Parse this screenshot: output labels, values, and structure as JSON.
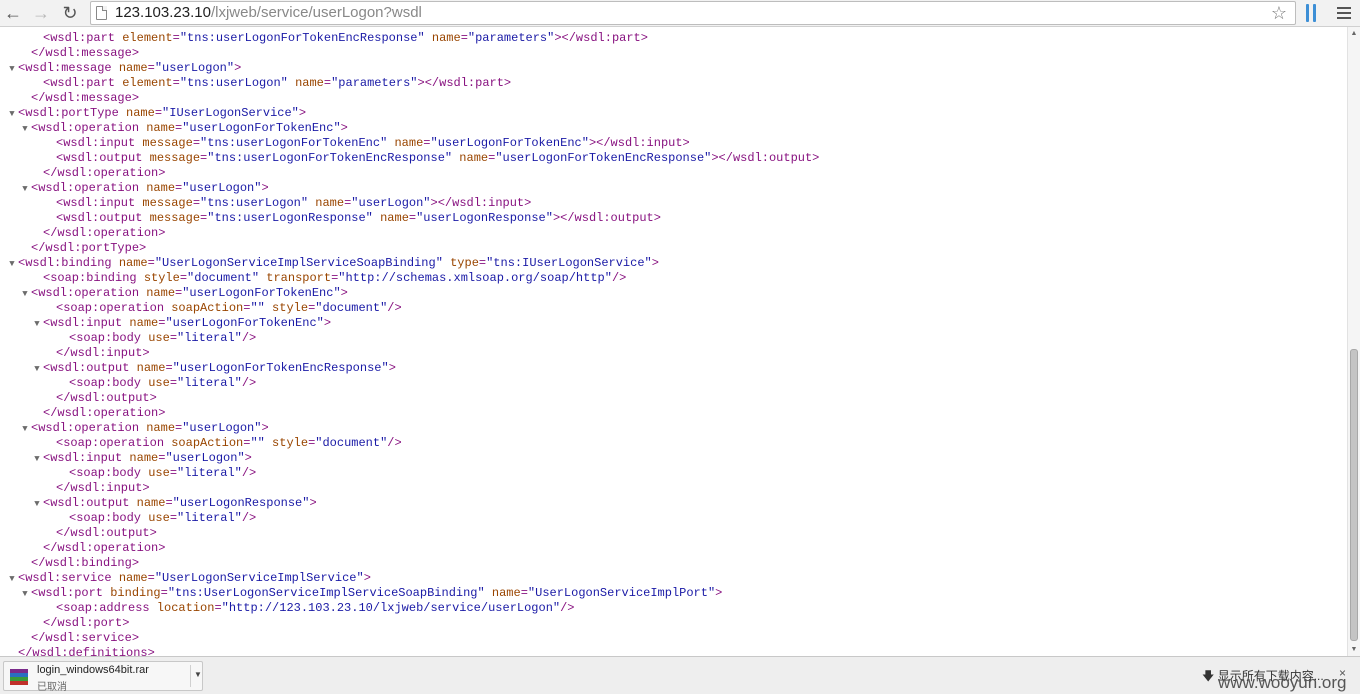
{
  "browser": {
    "url_host": "123.103.23.10",
    "url_path": "/lxjweb/service/userLogon?wsdl",
    "icons": {
      "back": "back-arrow-icon",
      "forward": "forward-arrow-icon",
      "reload": "reload-icon",
      "bookmark": "star-icon",
      "extension": "extension-icon",
      "menu": "menu-icon"
    }
  },
  "xml_lines": [
    {
      "indent": 3,
      "toggle": false,
      "parts": [
        [
          "t",
          "<wsdl:part "
        ],
        [
          "a",
          "element"
        ],
        [
          "t",
          "="
        ],
        [
          "v",
          "\"tns:userLogonForTokenEncResponse\""
        ],
        [
          "t",
          " "
        ],
        [
          "a",
          "name"
        ],
        [
          "t",
          "="
        ],
        [
          "v",
          "\"parameters\""
        ],
        [
          "t",
          "></wsdl:part>"
        ]
      ]
    },
    {
      "indent": 2,
      "toggle": false,
      "parts": [
        [
          "t",
          "</wsdl:message>"
        ]
      ]
    },
    {
      "indent": 1,
      "toggle": true,
      "parts": [
        [
          "t",
          "<wsdl:message "
        ],
        [
          "a",
          "name"
        ],
        [
          "t",
          "="
        ],
        [
          "v",
          "\"userLogon\""
        ],
        [
          "t",
          ">"
        ]
      ]
    },
    {
      "indent": 3,
      "toggle": false,
      "parts": [
        [
          "t",
          "<wsdl:part "
        ],
        [
          "a",
          "element"
        ],
        [
          "t",
          "="
        ],
        [
          "v",
          "\"tns:userLogon\""
        ],
        [
          "t",
          " "
        ],
        [
          "a",
          "name"
        ],
        [
          "t",
          "="
        ],
        [
          "v",
          "\"parameters\""
        ],
        [
          "t",
          "></wsdl:part>"
        ]
      ]
    },
    {
      "indent": 2,
      "toggle": false,
      "parts": [
        [
          "t",
          "</wsdl:message>"
        ]
      ]
    },
    {
      "indent": 1,
      "toggle": true,
      "parts": [
        [
          "t",
          "<wsdl:portType "
        ],
        [
          "a",
          "name"
        ],
        [
          "t",
          "="
        ],
        [
          "v",
          "\"IUserLogonService\""
        ],
        [
          "t",
          ">"
        ]
      ]
    },
    {
      "indent": 2,
      "toggle": true,
      "parts": [
        [
          "t",
          "<wsdl:operation "
        ],
        [
          "a",
          "name"
        ],
        [
          "t",
          "="
        ],
        [
          "v",
          "\"userLogonForTokenEnc\""
        ],
        [
          "t",
          ">"
        ]
      ]
    },
    {
      "indent": 4,
      "toggle": false,
      "parts": [
        [
          "t",
          "<wsdl:input "
        ],
        [
          "a",
          "message"
        ],
        [
          "t",
          "="
        ],
        [
          "v",
          "\"tns:userLogonForTokenEnc\""
        ],
        [
          "t",
          " "
        ],
        [
          "a",
          "name"
        ],
        [
          "t",
          "="
        ],
        [
          "v",
          "\"userLogonForTokenEnc\""
        ],
        [
          "t",
          "></wsdl:input>"
        ]
      ]
    },
    {
      "indent": 4,
      "toggle": false,
      "parts": [
        [
          "t",
          "<wsdl:output "
        ],
        [
          "a",
          "message"
        ],
        [
          "t",
          "="
        ],
        [
          "v",
          "\"tns:userLogonForTokenEncResponse\""
        ],
        [
          "t",
          " "
        ],
        [
          "a",
          "name"
        ],
        [
          "t",
          "="
        ],
        [
          "v",
          "\"userLogonForTokenEncResponse\""
        ],
        [
          "t",
          "></wsdl:output>"
        ]
      ]
    },
    {
      "indent": 3,
      "toggle": false,
      "parts": [
        [
          "t",
          "</wsdl:operation>"
        ]
      ]
    },
    {
      "indent": 2,
      "toggle": true,
      "parts": [
        [
          "t",
          "<wsdl:operation "
        ],
        [
          "a",
          "name"
        ],
        [
          "t",
          "="
        ],
        [
          "v",
          "\"userLogon\""
        ],
        [
          "t",
          ">"
        ]
      ]
    },
    {
      "indent": 4,
      "toggle": false,
      "parts": [
        [
          "t",
          "<wsdl:input "
        ],
        [
          "a",
          "message"
        ],
        [
          "t",
          "="
        ],
        [
          "v",
          "\"tns:userLogon\""
        ],
        [
          "t",
          " "
        ],
        [
          "a",
          "name"
        ],
        [
          "t",
          "="
        ],
        [
          "v",
          "\"userLogon\""
        ],
        [
          "t",
          "></wsdl:input>"
        ]
      ]
    },
    {
      "indent": 4,
      "toggle": false,
      "parts": [
        [
          "t",
          "<wsdl:output "
        ],
        [
          "a",
          "message"
        ],
        [
          "t",
          "="
        ],
        [
          "v",
          "\"tns:userLogonResponse\""
        ],
        [
          "t",
          " "
        ],
        [
          "a",
          "name"
        ],
        [
          "t",
          "="
        ],
        [
          "v",
          "\"userLogonResponse\""
        ],
        [
          "t",
          "></wsdl:output>"
        ]
      ]
    },
    {
      "indent": 3,
      "toggle": false,
      "parts": [
        [
          "t",
          "</wsdl:operation>"
        ]
      ]
    },
    {
      "indent": 2,
      "toggle": false,
      "parts": [
        [
          "t",
          "</wsdl:portType>"
        ]
      ]
    },
    {
      "indent": 1,
      "toggle": true,
      "parts": [
        [
          "t",
          "<wsdl:binding "
        ],
        [
          "a",
          "name"
        ],
        [
          "t",
          "="
        ],
        [
          "v",
          "\"UserLogonServiceImplServiceSoapBinding\""
        ],
        [
          "t",
          " "
        ],
        [
          "a",
          "type"
        ],
        [
          "t",
          "="
        ],
        [
          "v",
          "\"tns:IUserLogonService\""
        ],
        [
          "t",
          ">"
        ]
      ]
    },
    {
      "indent": 3,
      "toggle": false,
      "parts": [
        [
          "t",
          "<soap:binding "
        ],
        [
          "a",
          "style"
        ],
        [
          "t",
          "="
        ],
        [
          "v",
          "\"document\""
        ],
        [
          "t",
          " "
        ],
        [
          "a",
          "transport"
        ],
        [
          "t",
          "="
        ],
        [
          "v",
          "\"http://schemas.xmlsoap.org/soap/http\""
        ],
        [
          "t",
          "/>"
        ]
      ]
    },
    {
      "indent": 2,
      "toggle": true,
      "parts": [
        [
          "t",
          "<wsdl:operation "
        ],
        [
          "a",
          "name"
        ],
        [
          "t",
          "="
        ],
        [
          "v",
          "\"userLogonForTokenEnc\""
        ],
        [
          "t",
          ">"
        ]
      ]
    },
    {
      "indent": 4,
      "toggle": false,
      "parts": [
        [
          "t",
          "<soap:operation "
        ],
        [
          "a",
          "soapAction"
        ],
        [
          "t",
          "="
        ],
        [
          "v",
          "\"\""
        ],
        [
          "t",
          " "
        ],
        [
          "a",
          "style"
        ],
        [
          "t",
          "="
        ],
        [
          "v",
          "\"document\""
        ],
        [
          "t",
          "/>"
        ]
      ]
    },
    {
      "indent": 3,
      "toggle": true,
      "parts": [
        [
          "t",
          "<wsdl:input "
        ],
        [
          "a",
          "name"
        ],
        [
          "t",
          "="
        ],
        [
          "v",
          "\"userLogonForTokenEnc\""
        ],
        [
          "t",
          ">"
        ]
      ]
    },
    {
      "indent": 5,
      "toggle": false,
      "parts": [
        [
          "t",
          "<soap:body "
        ],
        [
          "a",
          "use"
        ],
        [
          "t",
          "="
        ],
        [
          "v",
          "\"literal\""
        ],
        [
          "t",
          "/>"
        ]
      ]
    },
    {
      "indent": 4,
      "toggle": false,
      "parts": [
        [
          "t",
          "</wsdl:input>"
        ]
      ]
    },
    {
      "indent": 3,
      "toggle": true,
      "parts": [
        [
          "t",
          "<wsdl:output "
        ],
        [
          "a",
          "name"
        ],
        [
          "t",
          "="
        ],
        [
          "v",
          "\"userLogonForTokenEncResponse\""
        ],
        [
          "t",
          ">"
        ]
      ]
    },
    {
      "indent": 5,
      "toggle": false,
      "parts": [
        [
          "t",
          "<soap:body "
        ],
        [
          "a",
          "use"
        ],
        [
          "t",
          "="
        ],
        [
          "v",
          "\"literal\""
        ],
        [
          "t",
          "/>"
        ]
      ]
    },
    {
      "indent": 4,
      "toggle": false,
      "parts": [
        [
          "t",
          "</wsdl:output>"
        ]
      ]
    },
    {
      "indent": 3,
      "toggle": false,
      "parts": [
        [
          "t",
          "</wsdl:operation>"
        ]
      ]
    },
    {
      "indent": 2,
      "toggle": true,
      "parts": [
        [
          "t",
          "<wsdl:operation "
        ],
        [
          "a",
          "name"
        ],
        [
          "t",
          "="
        ],
        [
          "v",
          "\"userLogon\""
        ],
        [
          "t",
          ">"
        ]
      ]
    },
    {
      "indent": 4,
      "toggle": false,
      "parts": [
        [
          "t",
          "<soap:operation "
        ],
        [
          "a",
          "soapAction"
        ],
        [
          "t",
          "="
        ],
        [
          "v",
          "\"\""
        ],
        [
          "t",
          " "
        ],
        [
          "a",
          "style"
        ],
        [
          "t",
          "="
        ],
        [
          "v",
          "\"document\""
        ],
        [
          "t",
          "/>"
        ]
      ]
    },
    {
      "indent": 3,
      "toggle": true,
      "parts": [
        [
          "t",
          "<wsdl:input "
        ],
        [
          "a",
          "name"
        ],
        [
          "t",
          "="
        ],
        [
          "v",
          "\"userLogon\""
        ],
        [
          "t",
          ">"
        ]
      ]
    },
    {
      "indent": 5,
      "toggle": false,
      "parts": [
        [
          "t",
          "<soap:body "
        ],
        [
          "a",
          "use"
        ],
        [
          "t",
          "="
        ],
        [
          "v",
          "\"literal\""
        ],
        [
          "t",
          "/>"
        ]
      ]
    },
    {
      "indent": 4,
      "toggle": false,
      "parts": [
        [
          "t",
          "</wsdl:input>"
        ]
      ]
    },
    {
      "indent": 3,
      "toggle": true,
      "parts": [
        [
          "t",
          "<wsdl:output "
        ],
        [
          "a",
          "name"
        ],
        [
          "t",
          "="
        ],
        [
          "v",
          "\"userLogonResponse\""
        ],
        [
          "t",
          ">"
        ]
      ]
    },
    {
      "indent": 5,
      "toggle": false,
      "parts": [
        [
          "t",
          "<soap:body "
        ],
        [
          "a",
          "use"
        ],
        [
          "t",
          "="
        ],
        [
          "v",
          "\"literal\""
        ],
        [
          "t",
          "/>"
        ]
      ]
    },
    {
      "indent": 4,
      "toggle": false,
      "parts": [
        [
          "t",
          "</wsdl:output>"
        ]
      ]
    },
    {
      "indent": 3,
      "toggle": false,
      "parts": [
        [
          "t",
          "</wsdl:operation>"
        ]
      ]
    },
    {
      "indent": 2,
      "toggle": false,
      "parts": [
        [
          "t",
          "</wsdl:binding>"
        ]
      ]
    },
    {
      "indent": 1,
      "toggle": true,
      "parts": [
        [
          "t",
          "<wsdl:service "
        ],
        [
          "a",
          "name"
        ],
        [
          "t",
          "="
        ],
        [
          "v",
          "\"UserLogonServiceImplService\""
        ],
        [
          "t",
          ">"
        ]
      ]
    },
    {
      "indent": 2,
      "toggle": true,
      "parts": [
        [
          "t",
          "<wsdl:port "
        ],
        [
          "a",
          "binding"
        ],
        [
          "t",
          "="
        ],
        [
          "v",
          "\"tns:UserLogonServiceImplServiceSoapBinding\""
        ],
        [
          "t",
          " "
        ],
        [
          "a",
          "name"
        ],
        [
          "t",
          "="
        ],
        [
          "v",
          "\"UserLogonServiceImplPort\""
        ],
        [
          "t",
          ">"
        ]
      ]
    },
    {
      "indent": 4,
      "toggle": false,
      "parts": [
        [
          "t",
          "<soap:address "
        ],
        [
          "a",
          "location"
        ],
        [
          "t",
          "="
        ],
        [
          "v",
          "\"http://123.103.23.10/lxjweb/service/userLogon\""
        ],
        [
          "t",
          "/>"
        ]
      ]
    },
    {
      "indent": 3,
      "toggle": false,
      "parts": [
        [
          "t",
          "</wsdl:port>"
        ]
      ]
    },
    {
      "indent": 2,
      "toggle": false,
      "parts": [
        [
          "t",
          "</wsdl:service>"
        ]
      ]
    },
    {
      "indent": 1,
      "toggle": false,
      "parts": [
        [
          "t",
          "</wsdl:definitions>"
        ]
      ]
    }
  ],
  "download": {
    "file_name": "login_windows64bit.rar",
    "status": "已取消",
    "show_all": "显示所有下载内容...",
    "close_glyph": "×",
    "file_icon": "rar-archive-icon"
  },
  "watermark": "www.wooyun.org",
  "colors": {
    "tag": "#881280",
    "attribute": "#994500",
    "value": "#1a1aa6",
    "extension_accent": "#3d8fd6"
  }
}
